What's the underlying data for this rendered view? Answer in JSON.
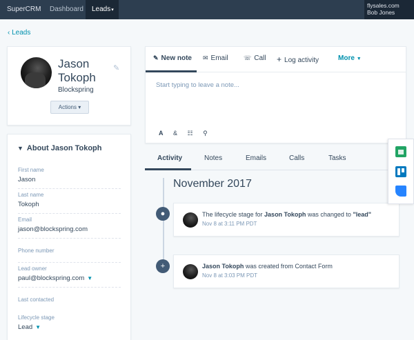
{
  "topbar": {
    "brand": "SuperCRM",
    "nav": [
      "Dashboard",
      "Leads"
    ],
    "nav_caret": "▾",
    "account_domain": "flysales.com",
    "account_user": "Bob Jones"
  },
  "back_link": "‹ Leads",
  "contact": {
    "name": "Jason Tokoph",
    "company": "Blockspring",
    "actions_label": "Actions ▾"
  },
  "about": {
    "title": "About Jason Tokoph",
    "fields": [
      {
        "label": "First name",
        "value": "Jason"
      },
      {
        "label": "Last name",
        "value": "Tokoph"
      },
      {
        "label": "Email",
        "value": "jason@blockspring.com"
      },
      {
        "label": "Phone number",
        "value": ""
      },
      {
        "label": "Lead owner",
        "value": "paul@blockspring.com"
      },
      {
        "label": "Last contacted",
        "value": ""
      },
      {
        "label": "Lifecycle stage",
        "value": "Lead"
      }
    ]
  },
  "composer": {
    "tabs": [
      "New note",
      "Email",
      "Call",
      "Log activity",
      "More"
    ],
    "placeholder": "Start typing to leave a note..."
  },
  "feed": {
    "tabs": [
      "Activity",
      "Notes",
      "Emails",
      "Calls",
      "Tasks"
    ],
    "month": "November 2017",
    "events": [
      {
        "pre": "The lifecycle stage for ",
        "name": "Jason Tokoph",
        "mid": " was changed to ",
        "value": "\"lead\"",
        "time": "Nov 8 at 3:11 PM PDT"
      },
      {
        "name": "Jason Tokoph",
        "rest": " was created from Contact Form",
        "time": "Nov 8 at 3:03 PM PDT"
      }
    ]
  },
  "side_panel": {
    "icons": [
      "google-sheets-icon",
      "trello-icon",
      "jira-icon"
    ]
  }
}
